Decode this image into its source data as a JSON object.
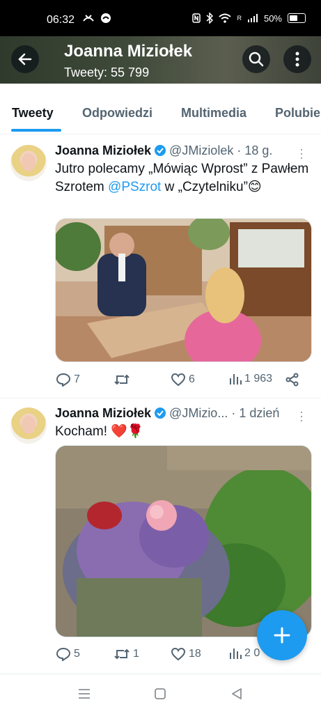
{
  "status_bar": {
    "time": "06:32",
    "battery": "50%",
    "network": "R"
  },
  "header": {
    "title": "Joanna Miziołek",
    "subtitle": "Tweety: 55 799",
    "back_icon": "arrow-left-icon",
    "search_icon": "search-icon",
    "more_icon": "more-vertical-icon"
  },
  "tabs": [
    {
      "label": "Tweety",
      "active": true
    },
    {
      "label": "Odpowiedzi"
    },
    {
      "label": "Multimedia"
    },
    {
      "label": "Polubie"
    }
  ],
  "tweets": [
    {
      "name": "Joanna Miziołek",
      "handle": "@JMiziolek",
      "time": "· 18 g.",
      "text_a": "Jutro polecamy „Mówiąc Wprost” z Pawłem Szrotem ",
      "mention": "@PSzrot",
      "text_b": " w „Czytelniku”😊",
      "actions": {
        "replies": "7",
        "retweets": "",
        "likes": "6",
        "views": "1 963"
      }
    },
    {
      "name": "Joanna Miziołek",
      "handle": "@JMizio...",
      "time": "· 1 dzień",
      "text_a": "Kocham! ❤️🌹",
      "actions": {
        "replies": "5",
        "retweets": "1",
        "likes": "18",
        "views": "2 0"
      }
    }
  ],
  "colors": {
    "accent": "#1d9bf0",
    "secondary_text": "#536471",
    "verified": "#1d9bf0"
  },
  "fab": {
    "icon": "plus-icon"
  },
  "nav_bar": {
    "icons": [
      "menu-icon",
      "home-square-icon",
      "back-triangle-icon"
    ]
  }
}
